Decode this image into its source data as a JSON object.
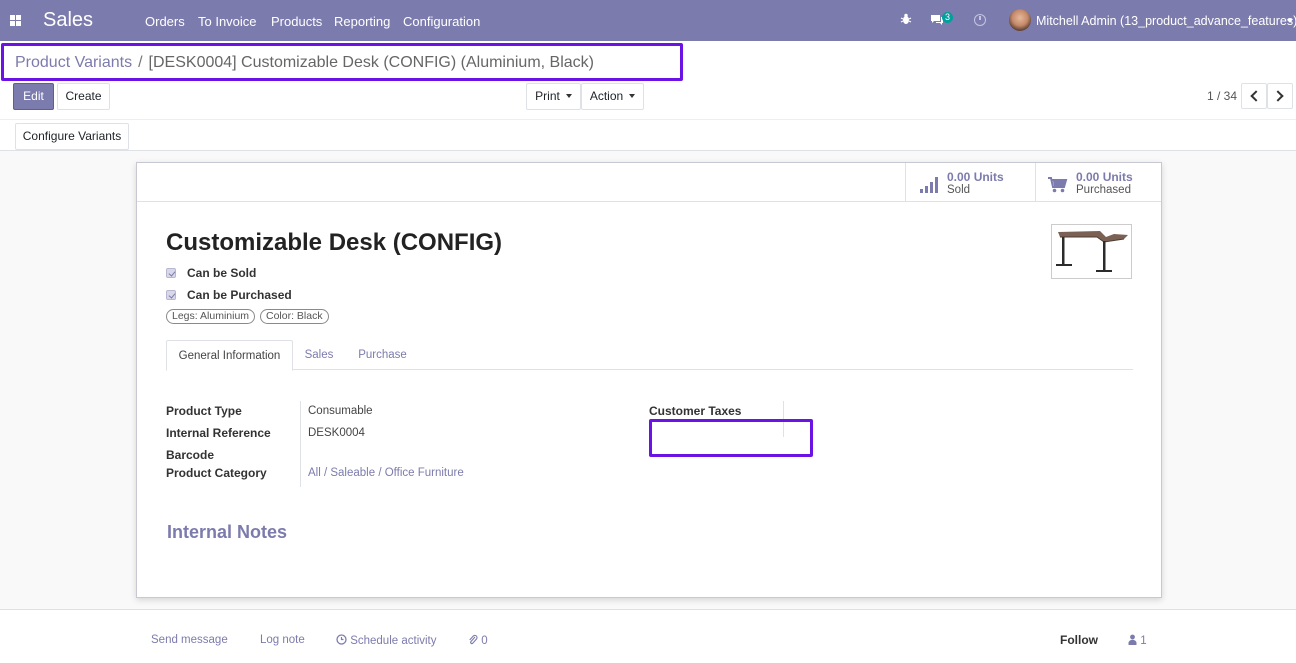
{
  "navbar": {
    "app_name": "Sales",
    "menu": [
      "Orders",
      "To Invoice",
      "Products",
      "Reporting",
      "Configuration"
    ],
    "chat_badge": "3",
    "user": "Mitchell Admin (13_product_advance_features)",
    "icons": [
      "apps-grid-icon",
      "bug-icon",
      "chat-icon",
      "clock-icon",
      "caret-down-icon"
    ]
  },
  "breadcrumb": {
    "parent": "Product Variants",
    "separator": "/",
    "current": "[DESK0004] Customizable Desk (CONFIG) (Aluminium, Black)"
  },
  "toolbar": {
    "edit": "Edit",
    "create": "Create",
    "print": "Print",
    "action": "Action",
    "configure_variants": "Configure Variants"
  },
  "pager": {
    "value": "1 / 34"
  },
  "stat_buttons": {
    "sold_value": "0.00 Units",
    "sold_label": "Sold",
    "purchased_value": "0.00 Units",
    "purchased_label": "Purchased"
  },
  "product": {
    "name": "Customizable Desk (CONFIG)",
    "can_be_sold": "Can be Sold",
    "can_be_purchased": "Can be Purchased",
    "attributes": [
      "Legs: Aluminium",
      "Color: Black"
    ]
  },
  "tabs": [
    "General Information",
    "Sales",
    "Purchase"
  ],
  "fields": {
    "product_type_label": "Product Type",
    "product_type_value": "Consumable",
    "internal_reference_label": "Internal Reference",
    "internal_reference_value": "DESK0004",
    "barcode_label": "Barcode",
    "product_category_label": "Product Category",
    "product_category_value": "All / Saleable / Office Furniture",
    "customer_taxes_label": "Customer Taxes"
  },
  "internal_notes_title": "Internal Notes",
  "chatter": {
    "send_message": "Send message",
    "log_note": "Log note",
    "schedule_activity": "Schedule activity",
    "attachments": "0",
    "follow": "Follow",
    "followers": "1"
  },
  "colors": {
    "brand": "#7c7bad",
    "highlight": "#6b13e5"
  }
}
